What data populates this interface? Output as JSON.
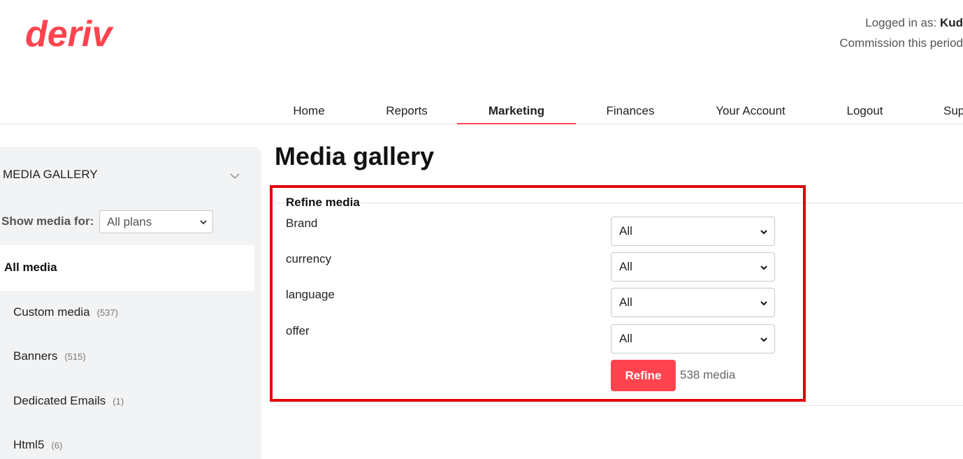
{
  "brand": {
    "logo_text": "deriv",
    "color": "#ff444f"
  },
  "account": {
    "logged_in_label": "Logged in as: ",
    "username": "Kud",
    "commission_label": "Commission this period"
  },
  "nav": {
    "items": [
      {
        "label": "Home"
      },
      {
        "label": "Reports"
      },
      {
        "label": "Marketing",
        "active": true
      },
      {
        "label": "Finances"
      },
      {
        "label": "Your Account"
      },
      {
        "label": "Logout"
      },
      {
        "label": "Sup"
      }
    ]
  },
  "sidebar": {
    "title": "MEDIA GALLERY",
    "show_media_label": "Show media for:",
    "plan_select_value": "All plans",
    "all_media_label": "All media",
    "items": [
      {
        "label": "Custom media",
        "count": "(537)"
      },
      {
        "label": "Banners",
        "count": "(515)"
      },
      {
        "label": "Dedicated Emails",
        "count": "(1)"
      },
      {
        "label": "Html5",
        "count": "(6)"
      }
    ]
  },
  "main": {
    "title": "Media gallery",
    "refine": {
      "legend": "Refine media",
      "fields": [
        {
          "label": "Brand",
          "value": "All"
        },
        {
          "label": "currency",
          "value": "All"
        },
        {
          "label": "language",
          "value": "All"
        },
        {
          "label": "offer",
          "value": "All"
        }
      ],
      "button_label": "Refine",
      "result_count": "538 media"
    }
  },
  "colors": {
    "accent": "#ff444f",
    "highlight": "#e0000b"
  },
  "icons": {
    "select_arrow": "chevron-down-icon",
    "sidebar_toggle": "chevron-down-icon"
  }
}
